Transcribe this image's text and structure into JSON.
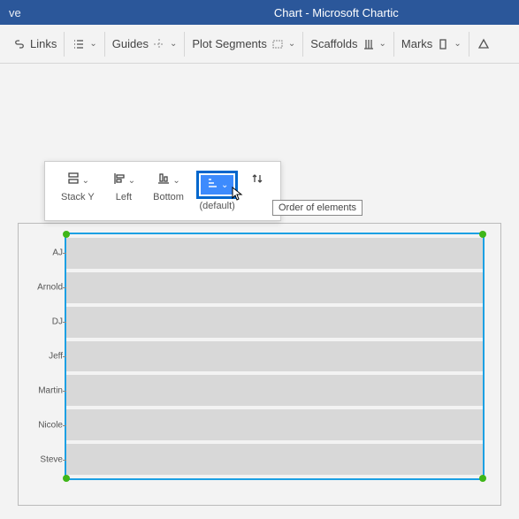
{
  "titlebar": {
    "left": "ve",
    "center": "Chart - Microsoft Chartic"
  },
  "ribbon": {
    "links_label": "Links",
    "guides_label": "Guides",
    "plotseg_label": "Plot Segments",
    "scaffolds_label": "Scaffolds",
    "marks_label": "Marks"
  },
  "floating": {
    "stacky_label": "Stack Y",
    "left_label": "Left",
    "bottom_label": "Bottom",
    "default_label": "(default)"
  },
  "tooltip": "Order of elements",
  "chart_data": {
    "type": "bar",
    "categories": [
      "AJ",
      "Arnold",
      "DJ",
      "Jeff",
      "Martin",
      "Nicole",
      "Steve"
    ],
    "values": [
      100,
      100,
      100,
      100,
      100,
      100,
      100
    ],
    "title": "",
    "xlabel": "",
    "ylabel": "",
    "xlim": [
      0,
      100
    ]
  }
}
